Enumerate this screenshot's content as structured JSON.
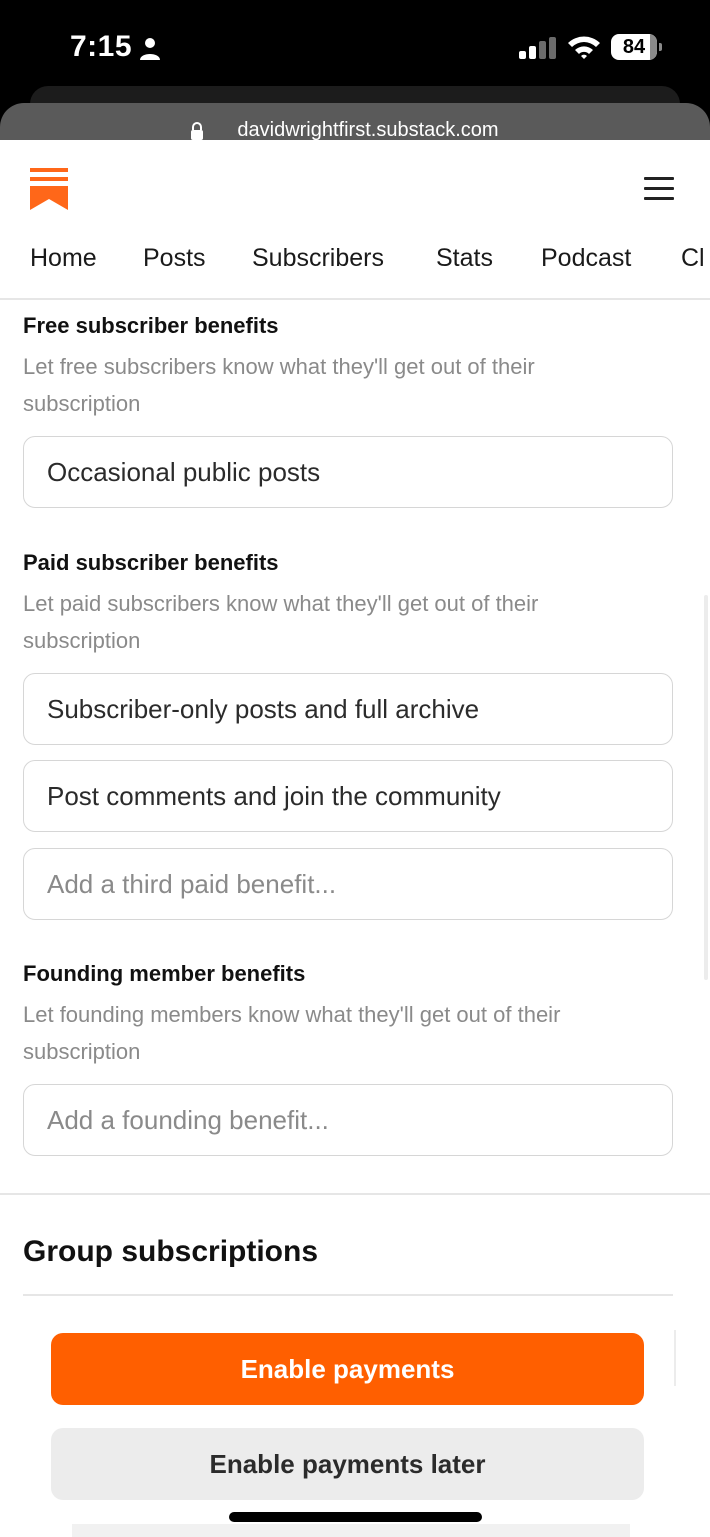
{
  "status_bar": {
    "time": "7:15",
    "battery_level": "84",
    "battery_fraction": 0.84,
    "icons": [
      "person-icon",
      "signal-icon",
      "wifi-icon",
      "battery-icon"
    ]
  },
  "browser": {
    "url": "davidwrightfirst.substack.com"
  },
  "header": {
    "logo_icon": "substack-logo-icon",
    "menu_icon": "hamburger-menu-icon",
    "nav": [
      "Home",
      "Posts",
      "Subscribers",
      "Stats",
      "Podcast",
      "Cl"
    ]
  },
  "sections": {
    "free": {
      "title": "Free subscriber benefits",
      "desc_line1": "Let free subscribers know what they'll get out of their",
      "desc_line2": "subscription",
      "fields": [
        "Occasional public posts"
      ]
    },
    "paid": {
      "title": "Paid subscriber benefits",
      "desc_line1": "Let paid subscribers know what they'll get out of their",
      "desc_line2": "subscription",
      "fields": [
        "Subscriber-only posts and full archive",
        "Post comments and join the community"
      ],
      "placeholder": "Add a third paid benefit..."
    },
    "founding": {
      "title": "Founding member benefits",
      "desc_line1": "Let founding members know what they'll get out of their",
      "desc_line2": "subscription",
      "placeholder": "Add a founding benefit..."
    }
  },
  "group": {
    "title": "Group subscriptions"
  },
  "buttons": {
    "enable": "Enable payments",
    "later": "Enable payments later"
  },
  "colors": {
    "accent": "#ff5f00",
    "status_bar": "#000000",
    "url_bar": "#5a5a5a"
  }
}
